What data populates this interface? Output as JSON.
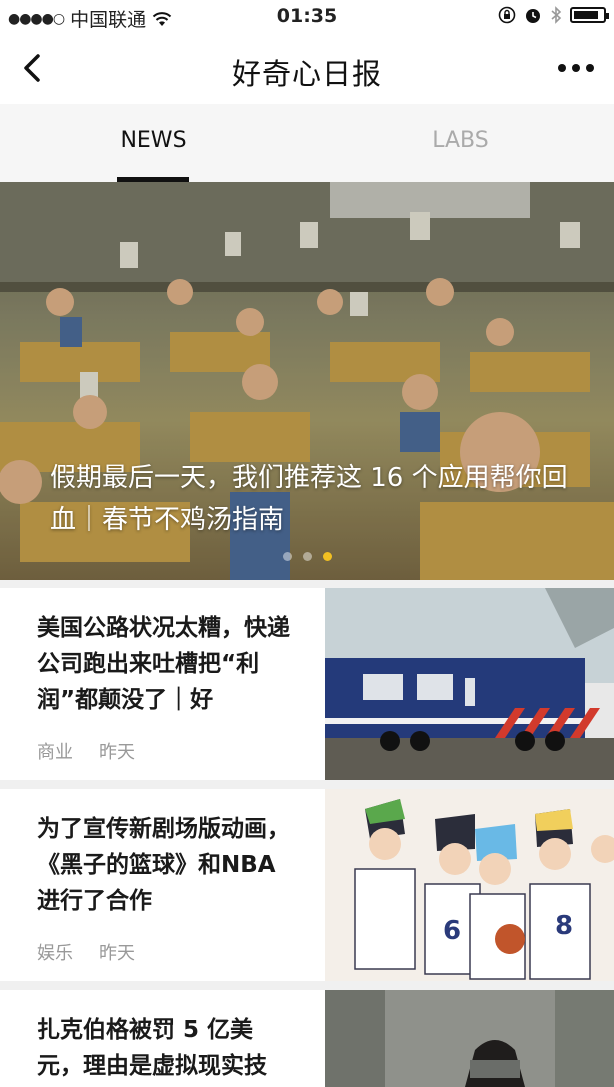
{
  "status_bar": {
    "signal": "●●●●○",
    "carrier": "中国联通",
    "time": "01:35"
  },
  "nav": {
    "title": "好奇心日报"
  },
  "tabs": [
    {
      "label": "NEWS",
      "active": true
    },
    {
      "label": "LABS",
      "active": false
    }
  ],
  "banner": {
    "title": "假期最后一天，我们推荐这 16 个应用帮你回血｜春节不鸡汤指南",
    "dots_total": 3,
    "active_dot": 2
  },
  "feed": [
    {
      "title": "美国公路状况太糟，快递公司跑出来吐槽把“利润”都颠没了｜好",
      "category": "商业",
      "time": "昨天"
    },
    {
      "title": "为了宣传新剧场版动画，《黑子的篮球》和NBA进行了合作",
      "category": "娱乐",
      "time": "昨天"
    },
    {
      "title": "扎克伯格被罚 5 亿美元，理由是虚拟现实技",
      "category": "",
      "time": ""
    }
  ],
  "colors": {
    "accent": "#f2c022",
    "tab_inactive": "#aaaaaa",
    "meta": "#999999"
  }
}
